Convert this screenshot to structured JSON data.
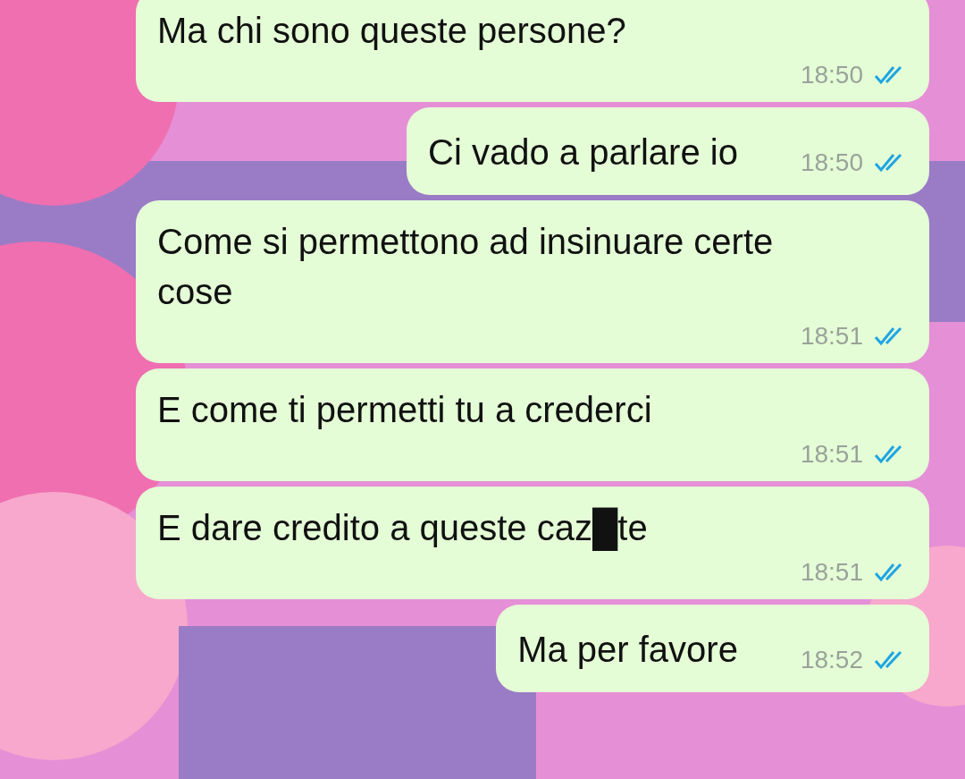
{
  "messages": [
    {
      "kind": "wide",
      "text": "Ma chi sono queste persone?",
      "time": "18:50",
      "read": true
    },
    {
      "kind": "inline",
      "text": "Ci vado a parlare io",
      "time": "18:50",
      "read": true
    },
    {
      "kind": "wide",
      "text": "Come si permettono ad insinuare certe cose",
      "time": "18:51",
      "read": true
    },
    {
      "kind": "wide",
      "text": "E come ti permetti tu a crederci",
      "time": "18:51",
      "read": true
    },
    {
      "kind": "wide",
      "text": "E dare credito a queste caz█te",
      "time": "18:51",
      "read": true
    },
    {
      "kind": "inline",
      "text": "Ma per favore",
      "time": "18:52",
      "read": true
    }
  ]
}
